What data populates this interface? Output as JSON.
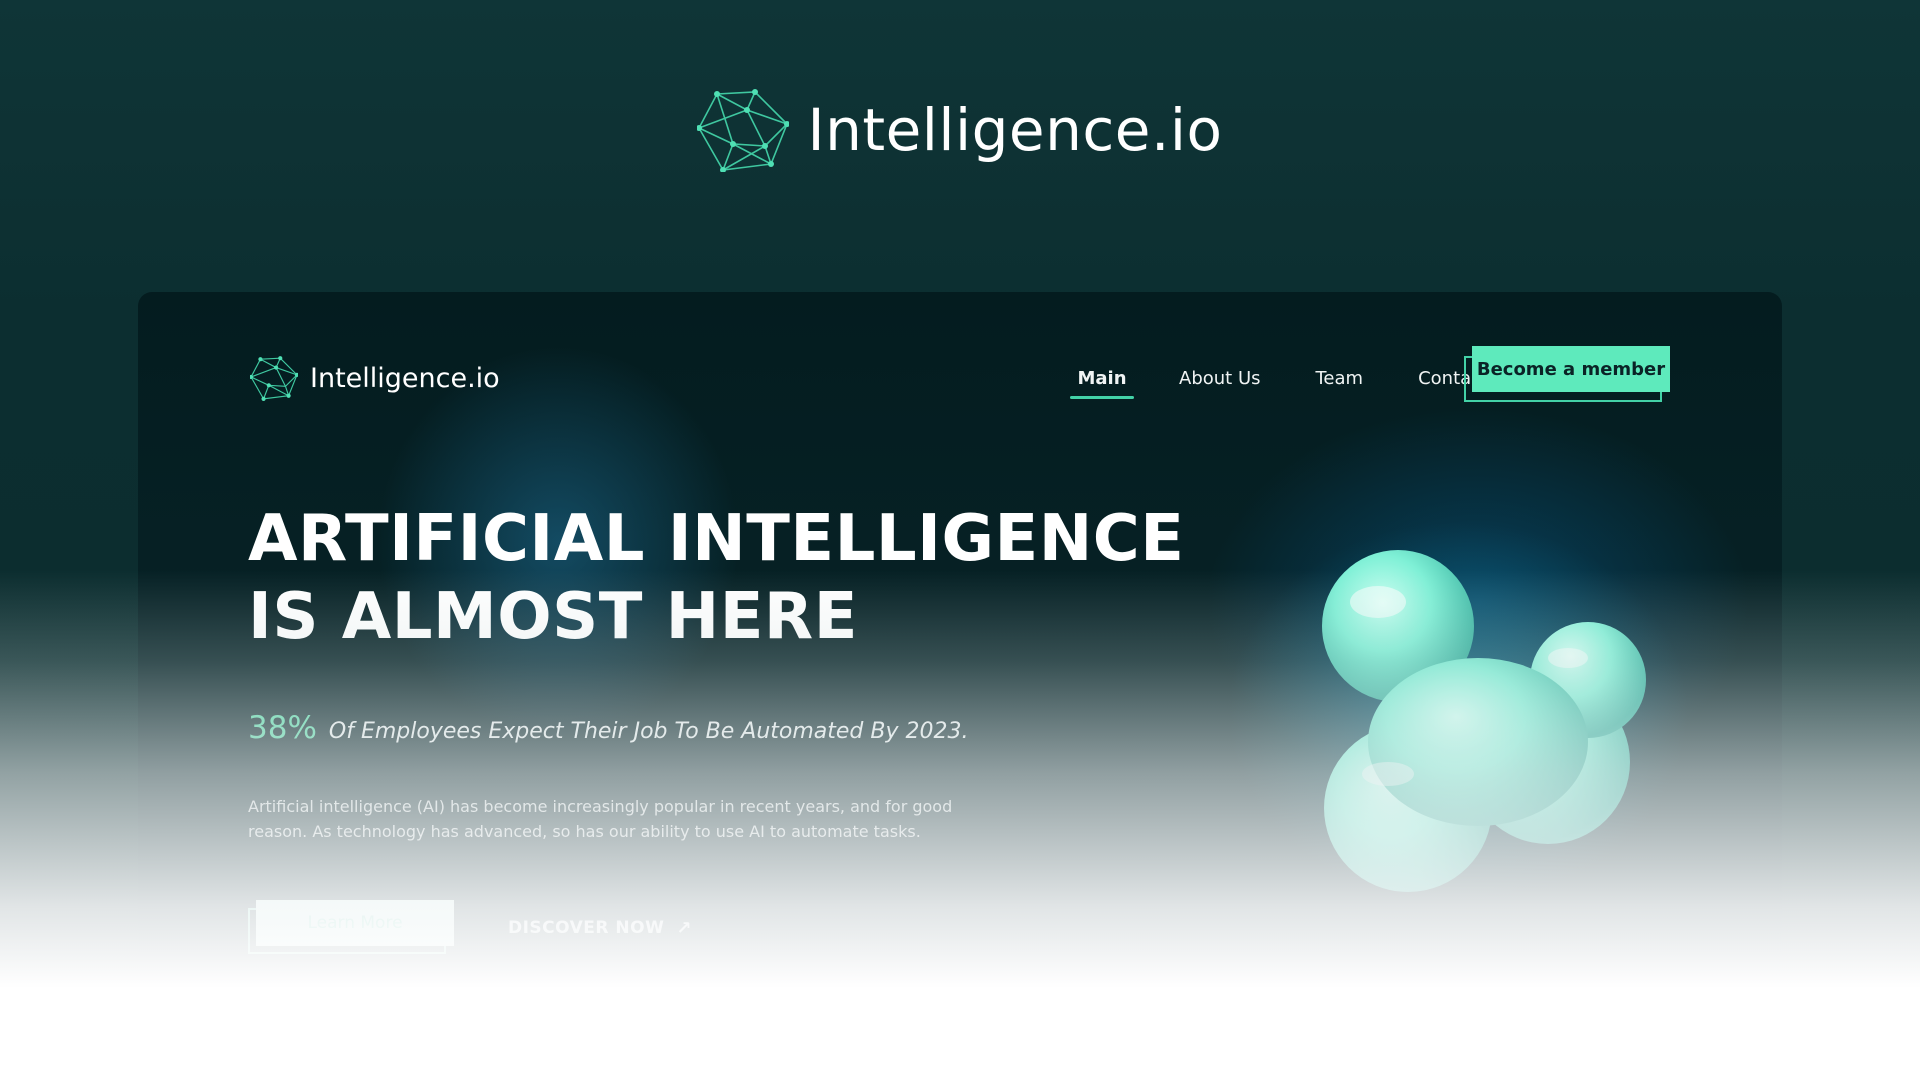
{
  "brand": {
    "name": "Intelligence.io",
    "icon": "network-polyhedron-logo",
    "accent": "#43d2a7"
  },
  "nav": {
    "brand": "Intelligence.io",
    "items": [
      {
        "label": "Main",
        "active": true
      },
      {
        "label": "About Us",
        "active": false
      },
      {
        "label": "Team",
        "active": false
      },
      {
        "label": "Contacts",
        "active": false
      }
    ],
    "cta": "Become a member"
  },
  "hero": {
    "title_line1": "ARTIFICIAL INTELLIGENCE",
    "title_line2": "IS ALMOST HERE",
    "stat_value": "38%",
    "stat_text": "Of Employees Expect Their Job To Be Automated By 2023.",
    "description": "Artificial intelligence (AI) has become increasingly popular in recent years, and for good reason. As technology has advanced, so has our ability to use AI to automate tasks.",
    "primary_button": "Learn More",
    "secondary_link": "DISCOVER NOW",
    "secondary_icon": "arrow-up-right-icon",
    "illustration": "mint-blob-3d"
  },
  "colors": {
    "background": "#0c2e30",
    "card": "#041c1f",
    "accent": "#5eeabc",
    "stat": "#57d8a7"
  }
}
